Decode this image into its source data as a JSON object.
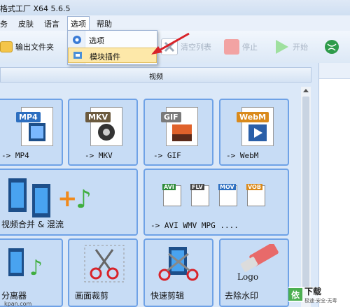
{
  "app": {
    "title": "格式工厂 X64 5.6.5"
  },
  "menubar": {
    "items": [
      {
        "label": "务"
      },
      {
        "label": "皮肤"
      },
      {
        "label": "语言"
      },
      {
        "label": "选项"
      },
      {
        "label": "帮助"
      }
    ]
  },
  "toolbar": {
    "output_folder": "输出文件夹",
    "clear_list": "清空列表",
    "stop": "停止",
    "start": "开始"
  },
  "dropdown": {
    "items": [
      {
        "label": "选项"
      },
      {
        "label": "模块插件"
      }
    ]
  },
  "section": {
    "title": "视频"
  },
  "tiles": [
    {
      "label": "-> MP4",
      "tag": "MP4"
    },
    {
      "label": "-> MKV",
      "tag": "MKV"
    },
    {
      "label": "-> GIF",
      "tag": "GIF"
    },
    {
      "label": "-> WebM",
      "tag": "WebM"
    },
    {
      "label": "视频合并 & 混流"
    },
    {
      "label": "-> AVI WMV MPG ....",
      "tags": [
        "AVI",
        "FLV",
        "MOV",
        "VOB"
      ]
    },
    {
      "label": "分离器"
    },
    {
      "label": "画面裁剪"
    },
    {
      "label": "快速剪辑"
    },
    {
      "label": "去除水印",
      "logo_text": "Logo"
    }
  ],
  "watermark": {
    "title": "下载",
    "sub": "极速·安全·无毒"
  },
  "footer_url": "kpan.com",
  "colors": {
    "accent": "#6fa2e6",
    "tile_bg": "#c7dcf5",
    "highlight": "#fde8a9"
  }
}
